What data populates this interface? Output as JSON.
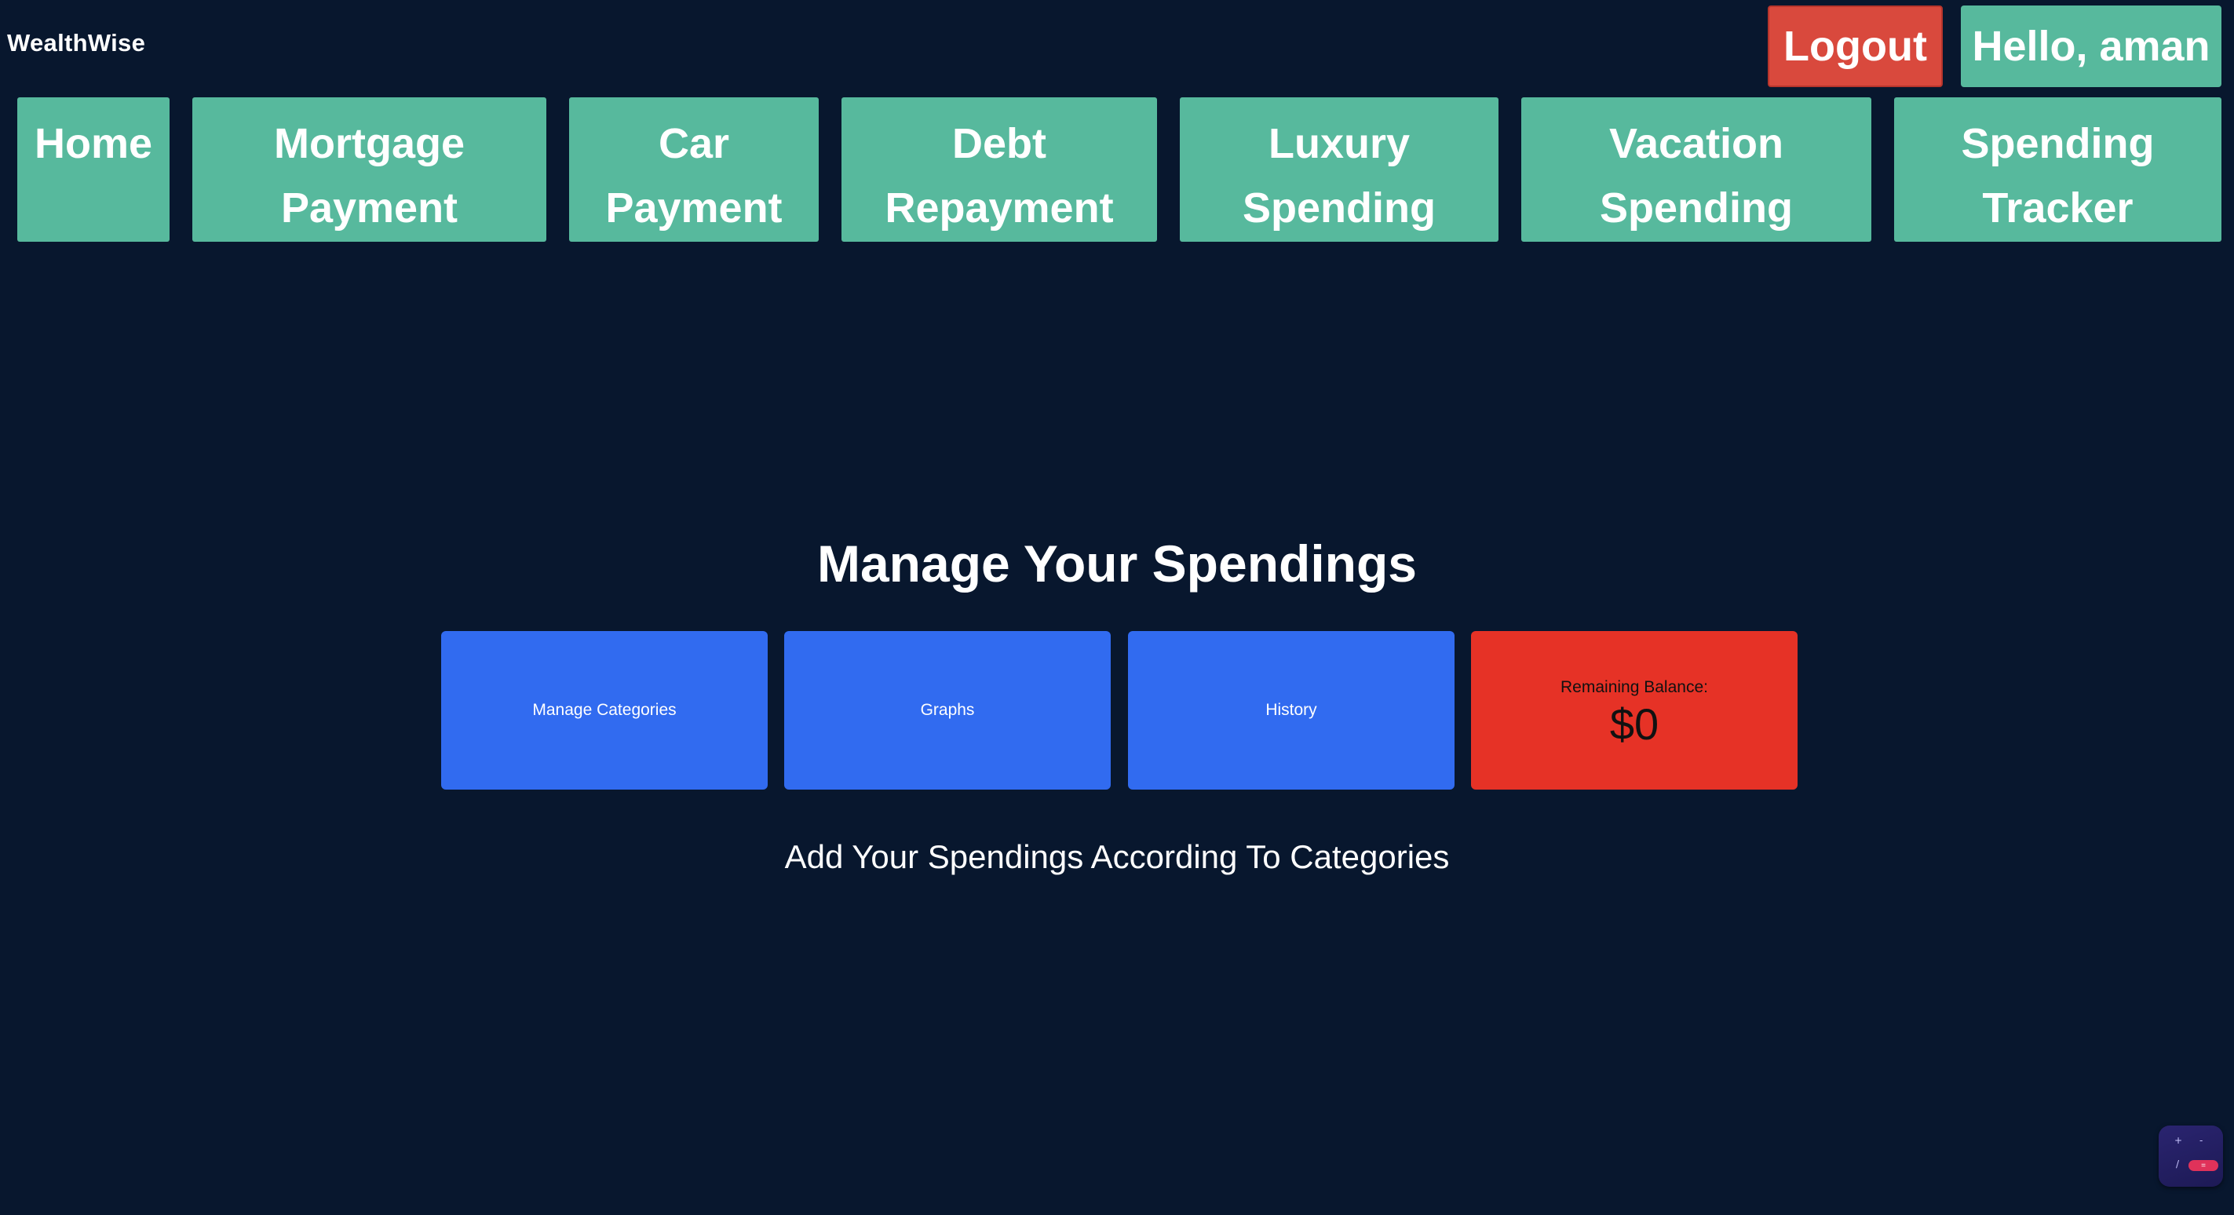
{
  "header": {
    "brand": "WealthWise",
    "logout_label": "Logout",
    "greeting": "Hello, aman"
  },
  "nav": {
    "items": [
      {
        "label": "Home"
      },
      {
        "label": "Mortgage\nPayment"
      },
      {
        "label": "Car\nPayment"
      },
      {
        "label": "Debt\nRepayment"
      },
      {
        "label": "Luxury\nSpending"
      },
      {
        "label": "Vacation\nSpending"
      },
      {
        "label": "Spending\nTracker"
      }
    ]
  },
  "main": {
    "title": "Manage Your Spendings",
    "cards": [
      {
        "label": "Manage Categories"
      },
      {
        "label": "Graphs"
      },
      {
        "label": "History"
      }
    ],
    "balance": {
      "label": "Remaining Balance:",
      "value": "$0"
    },
    "subtitle": "Add Your Spendings According To Categories"
  },
  "widget": {
    "plus": "+",
    "minus": "-",
    "slash": "/",
    "pill": "="
  },
  "colors": {
    "background": "#08172e",
    "nav_green": "#57b99d",
    "logout_red": "#d9493d",
    "card_blue": "#316bf0",
    "balance_red": "#e63226"
  }
}
